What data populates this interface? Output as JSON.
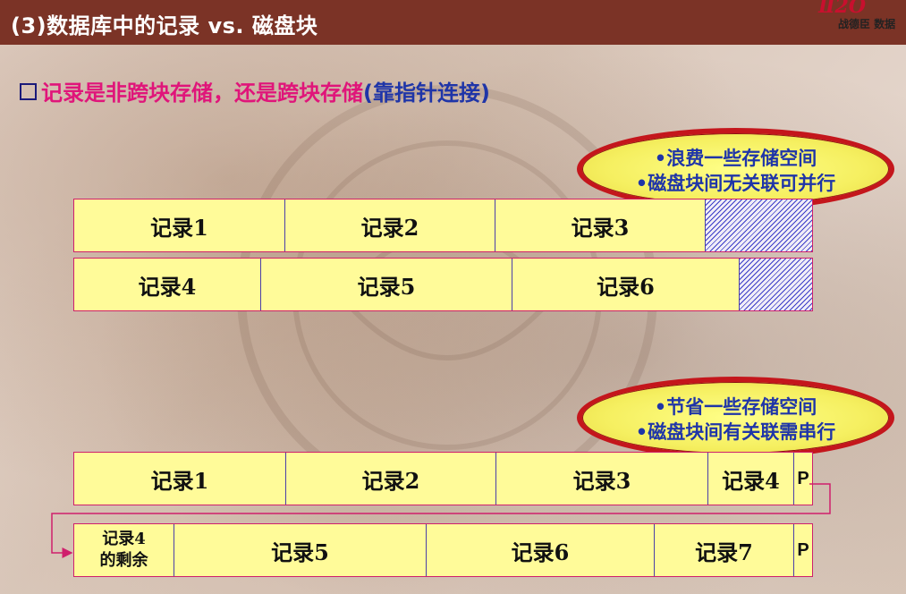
{
  "slide": {
    "title": "(3)数据库中的记录 vs. 磁盘块",
    "logo_text": "战德臣 数据",
    "heading_part1": "记录是非跨块存储，还是跨块存储",
    "heading_part2": "(靠指针连接)"
  },
  "top_callout": {
    "line1": "•浪费一些存储空间",
    "line2": "•磁盘块间无关联可并行"
  },
  "bottom_callout": {
    "line1": "•节省一些存储空间",
    "line2": "•磁盘块间有关联需串行"
  },
  "non_spanning": {
    "block1": [
      "记录1",
      "记录2",
      "记录3"
    ],
    "block2": [
      "记录4",
      "记录5",
      "记录6"
    ]
  },
  "spanning": {
    "block1": [
      "记录1",
      "记录2",
      "记录3",
      "记录4",
      "P"
    ],
    "block2_first_line1": "记录4",
    "block2_first_line2": "的剩余",
    "block2": [
      "记录5",
      "记录6",
      "记录7",
      "P"
    ]
  },
  "colors": {
    "title_bar": "#7b3326",
    "accent_pink": "#e0157a",
    "accent_blue": "#1f35a8",
    "block_fill": "#fffb99",
    "callout_border": "#c4161c"
  }
}
